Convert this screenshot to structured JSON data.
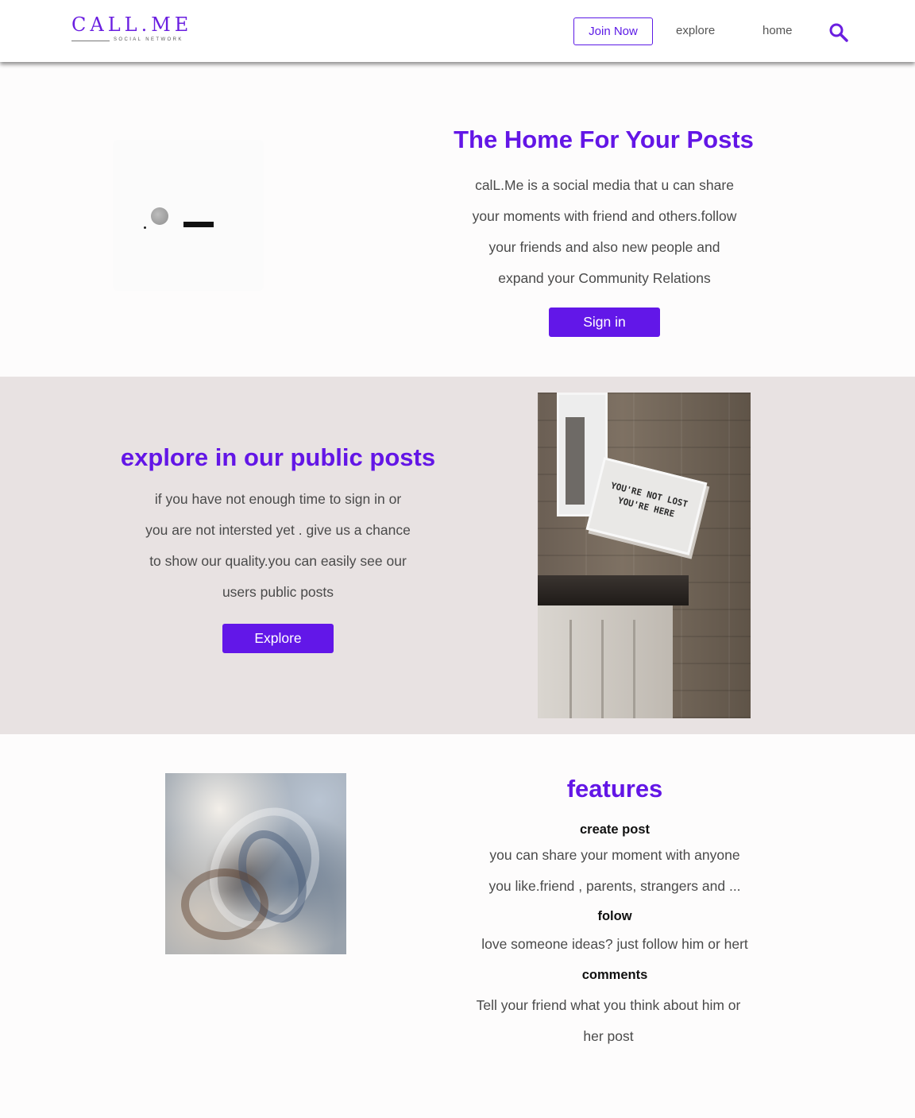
{
  "header": {
    "logo_text": "CALL.ME",
    "logo_subtitle": "SOCIAL NETWORK",
    "join_label": "Join Now",
    "nav": {
      "explore": "explore",
      "home": "home"
    },
    "search_icon": "search-icon"
  },
  "hero": {
    "title": "The Home For Your Posts",
    "lines": [
      "calL.Me is a social media that u can share",
      "your moments with friend and others.follow",
      "your friends and also new people and",
      "expand your Community Relations"
    ],
    "signin_label": "Sign in"
  },
  "explore_section": {
    "title": "explore in our public posts",
    "lines": [
      "if you have not enough time to sign in or",
      "you are not intersted yet . give us a chance",
      "to show our quality.you can easily see our",
      "users public posts"
    ],
    "button_label": "Explore",
    "photo_sign_lines": [
      "YOU'RE NOT LOST",
      "YOU'RE HERE"
    ]
  },
  "features": {
    "title": "features",
    "items": [
      {
        "heading": "create post",
        "lines": [
          "you can share your moment with anyone",
          "you like.friend , parents, strangers and ..."
        ]
      },
      {
        "heading": "folow",
        "lines": [
          "love someone ideas? just follow him or hert"
        ]
      },
      {
        "heading": "comments",
        "lines": [
          "Tell your friend what you think about him or",
          "her post"
        ]
      }
    ]
  },
  "colors": {
    "accent": "#6217e8",
    "band_background": "#e8e2e2",
    "page_background": "#fdfcfc"
  }
}
